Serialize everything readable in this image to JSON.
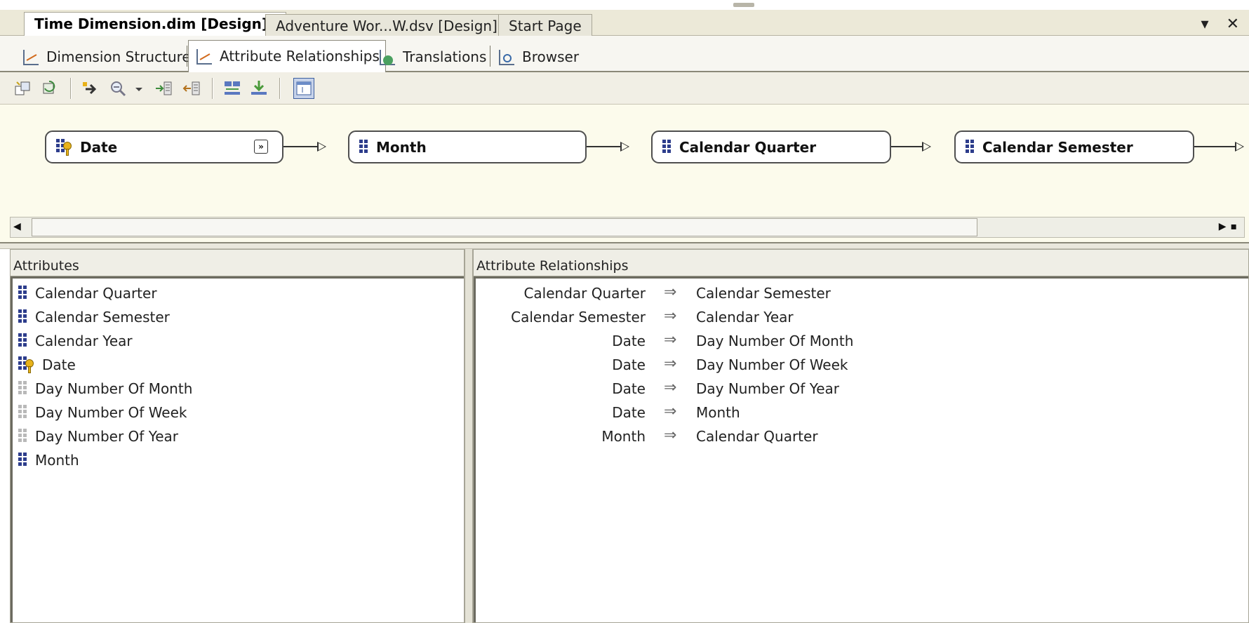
{
  "document_tabs": [
    {
      "label": "Time Dimension.dim [Design]*",
      "active": true
    },
    {
      "label": "Adventure Wor...W.dsv [Design]",
      "active": false
    },
    {
      "label": "Start Page",
      "active": false
    }
  ],
  "window_controls": {
    "dropdown": "▾",
    "close": "✕"
  },
  "designer_tabs": [
    {
      "label": "Dimension Structure",
      "icon": "dimension-structure-icon",
      "active": false
    },
    {
      "label": "Attribute Relationships",
      "icon": "attribute-relationships-icon",
      "active": true
    },
    {
      "label": "Translations",
      "icon": "translations-icon",
      "active": false
    },
    {
      "label": "Browser",
      "icon": "browser-icon",
      "active": false
    }
  ],
  "toolbar": {
    "buttons": [
      "new-attribute-relationship-icon",
      "new-attribute-icon",
      "arrow-right-icon",
      "zoom-icon",
      "zoom-dropdown-icon",
      "expand-all-icon",
      "collapse-all-icon",
      "arrange-icon",
      "fit-to-window-icon",
      "show-list-views-icon"
    ]
  },
  "diagram": {
    "nodes": [
      {
        "label": "Date",
        "type": "key"
      },
      {
        "label": "Month",
        "type": "attribute"
      },
      {
        "label": "Calendar Quarter",
        "type": "attribute"
      },
      {
        "label": "Calendar Semester",
        "type": "attribute"
      }
    ],
    "expand_glyph": "»"
  },
  "attributes_pane": {
    "title": "Attributes",
    "items": [
      {
        "label": "Calendar Quarter",
        "icon": "attribute"
      },
      {
        "label": "Calendar Semester",
        "icon": "attribute"
      },
      {
        "label": "Calendar Year",
        "icon": "attribute"
      },
      {
        "label": "Date",
        "icon": "key"
      },
      {
        "label": "Day Number Of Month",
        "icon": "attribute-disabled"
      },
      {
        "label": "Day Number Of Week",
        "icon": "attribute-disabled"
      },
      {
        "label": "Day Number Of Year",
        "icon": "attribute-disabled"
      },
      {
        "label": "Month",
        "icon": "attribute"
      }
    ]
  },
  "relationships_pane": {
    "title": "Attribute Relationships",
    "arrow_glyph": "⇒",
    "rows": [
      {
        "source": "Calendar Quarter",
        "target": "Calendar Semester"
      },
      {
        "source": "Calendar Semester",
        "target": "Calendar Year"
      },
      {
        "source": "Date",
        "target": "Day Number Of Month"
      },
      {
        "source": "Date",
        "target": "Day Number Of Week"
      },
      {
        "source": "Date",
        "target": "Day Number Of Year"
      },
      {
        "source": "Date",
        "target": "Month"
      },
      {
        "source": "Month",
        "target": "Calendar Quarter"
      }
    ]
  }
}
